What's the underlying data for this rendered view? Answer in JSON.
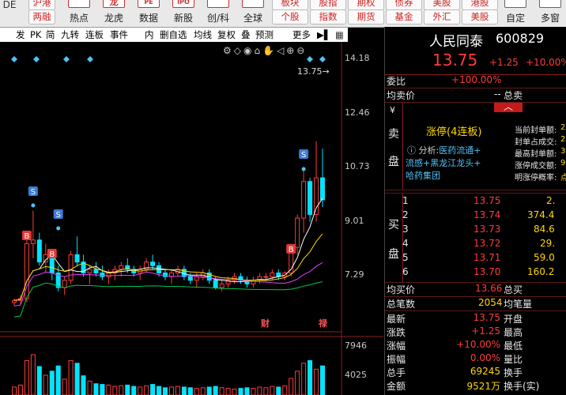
{
  "top": {
    "row1": [
      "沪港",
      "板块",
      "股指",
      "期权",
      "债券",
      "美股",
      "港股"
    ],
    "left_cut": "DE",
    "btn_row": [
      "两融",
      "热点",
      "龙虎",
      "数据",
      "新股",
      "创/科",
      "全球"
    ],
    "icon_lbl": [
      "",
      "",
      "龙",
      "PE",
      "IPO",
      "",
      ""
    ],
    "pills": [
      "个股",
      "指数",
      "期货",
      "基金",
      "外汇",
      "美股"
    ],
    "right": [
      "自定",
      "多窗"
    ]
  },
  "toolbar": [
    "发",
    "PK",
    "简",
    "九转",
    "连板",
    "事件",
    "内",
    "删自选",
    "均线",
    "复权",
    "叠",
    "预测",
    "更多"
  ],
  "chart": {
    "price_labels": [
      "14.18",
      "12.46",
      "10.73",
      "9.01",
      "7.29"
    ],
    "vol_labels": [
      "7946",
      "4025"
    ],
    "last_price_tag": "13.75",
    "marker_s": "S",
    "marker_b": "B",
    "event_a": "财",
    "event_b": "禄"
  },
  "chart_data": {
    "type": "candlestick",
    "y_range": [
      6.9,
      14.5
    ],
    "candles": [
      [
        7.6,
        7.7,
        7.5,
        7.65
      ],
      [
        7.65,
        7.8,
        7.55,
        7.7
      ],
      [
        7.7,
        9.4,
        7.6,
        9.2
      ],
      [
        9.2,
        10.1,
        8.8,
        9.3
      ],
      [
        9.3,
        9.5,
        8.6,
        8.7
      ],
      [
        8.7,
        9.2,
        8.4,
        8.9
      ],
      [
        8.9,
        9.0,
        8.2,
        8.4
      ],
      [
        8.4,
        8.6,
        7.9,
        8.0
      ],
      [
        8.0,
        8.3,
        7.8,
        8.2
      ],
      [
        8.2,
        9.0,
        8.1,
        8.9
      ],
      [
        8.9,
        9.4,
        8.6,
        8.7
      ],
      [
        8.7,
        8.9,
        8.3,
        8.4
      ],
      [
        8.4,
        8.6,
        8.1,
        8.5
      ],
      [
        8.5,
        8.7,
        8.3,
        8.4
      ],
      [
        8.4,
        8.6,
        8.2,
        8.3
      ],
      [
        8.3,
        8.5,
        8.1,
        8.4
      ],
      [
        8.4,
        8.6,
        8.2,
        8.5
      ],
      [
        8.5,
        8.7,
        8.3,
        8.6
      ],
      [
        8.6,
        8.8,
        8.4,
        8.5
      ],
      [
        8.5,
        8.6,
        8.3,
        8.4
      ],
      [
        8.4,
        8.6,
        8.2,
        8.5
      ],
      [
        8.5,
        8.8,
        8.4,
        8.7
      ],
      [
        8.7,
        8.9,
        8.5,
        8.6
      ],
      [
        8.6,
        8.7,
        8.3,
        8.4
      ],
      [
        8.4,
        8.5,
        8.2,
        8.3
      ],
      [
        8.3,
        8.5,
        8.1,
        8.4
      ],
      [
        8.4,
        8.6,
        8.3,
        8.5
      ],
      [
        8.5,
        8.6,
        8.2,
        8.3
      ],
      [
        8.3,
        8.4,
        8.1,
        8.2
      ],
      [
        8.2,
        8.4,
        8.0,
        8.3
      ],
      [
        8.3,
        8.5,
        8.2,
        8.4
      ],
      [
        8.4,
        8.5,
        8.1,
        8.2
      ],
      [
        8.2,
        8.3,
        7.95,
        8.0
      ],
      [
        8.0,
        8.2,
        7.9,
        8.1
      ],
      [
        8.1,
        8.3,
        8.0,
        8.2
      ],
      [
        8.2,
        8.4,
        8.1,
        8.3
      ],
      [
        8.3,
        8.4,
        8.1,
        8.2
      ],
      [
        8.2,
        8.3,
        8.0,
        8.1
      ],
      [
        8.1,
        8.3,
        8.0,
        8.2
      ],
      [
        8.2,
        8.4,
        8.1,
        8.3
      ],
      [
        8.3,
        8.4,
        8.2,
        8.3
      ],
      [
        8.3,
        8.5,
        8.2,
        8.4
      ],
      [
        8.4,
        8.5,
        8.2,
        8.3
      ],
      [
        8.3,
        8.45,
        8.2,
        8.4
      ],
      [
        8.4,
        9.2,
        8.3,
        9.1
      ],
      [
        9.1,
        10.0,
        8.9,
        9.9
      ],
      [
        9.9,
        11.2,
        9.5,
        10.9
      ],
      [
        10.9,
        11.0,
        9.8,
        10.0
      ],
      [
        10.0,
        12.0,
        9.8,
        11.0
      ],
      [
        11.0,
        11.8,
        10.2,
        10.4
      ]
    ],
    "volumes": [
      1200,
      1500,
      5200,
      6100,
      4300,
      3000,
      3600,
      4400,
      2400,
      5200,
      4800,
      2900,
      2100,
      1700,
      1600,
      1500,
      1300,
      1400,
      1500,
      1300,
      1200,
      1400,
      1600,
      1300,
      1100,
      1200,
      1300,
      1200,
      1100,
      1000,
      1100,
      1200,
      1300,
      1100,
      1000,
      900,
      1000,
      1100,
      1000,
      1200,
      1100,
      1300,
      1200,
      1400,
      2500,
      3600,
      4800,
      5200,
      3900,
      4400
    ]
  },
  "right_panel": {
    "name": "人民同泰",
    "code": "600829",
    "price": "13.75",
    "change": "+1.25",
    "pct": "+10.00%",
    "weibi_label": "委比",
    "weibi_val": "+100.00%",
    "junmai_label": "均卖价",
    "junmai_val": "--",
    "zongmai_label": "总卖",
    "sell_char1": "¥",
    "sell_char2": "卖",
    "sell_char3": "盘",
    "limit_up": "涨停(4连板)",
    "analysis_label": "分析:",
    "analysis_line1": "医药流通+",
    "analysis_line2": "流感+黑龙江龙头+",
    "analysis_line3": "哈药集团",
    "stats_labels": [
      "当前封单额:",
      "封单占成交:",
      "最高封单额:",
      "涨停成交额:",
      "明涨停概率:"
    ],
    "stats_vals": [
      "2",
      "2",
      "3",
      "9",
      "点"
    ],
    "buy_char1": "买",
    "buy_char2": "盘",
    "buys": [
      {
        "lvl": "1",
        "price": "13.75",
        "vol": "2."
      },
      {
        "lvl": "2",
        "price": "13.74",
        "vol": "374.4"
      },
      {
        "lvl": "3",
        "price": "13.73",
        "vol": "84.6"
      },
      {
        "lvl": "4",
        "price": "13.72",
        "vol": "29."
      },
      {
        "lvl": "5",
        "price": "13.71",
        "vol": "59.0"
      },
      {
        "lvl": "6",
        "price": "13.70",
        "vol": "160.2"
      }
    ],
    "junbuy_label": "均买价",
    "junbuy_val": "13.66",
    "zongbuy_label": "总买",
    "zongbi_label": "总笔数",
    "zongbi_val": "2054",
    "junbi_label": "均笔量",
    "quotes": [
      {
        "l": "最新",
        "v": "13.75",
        "r": "开盘",
        "c": "red"
      },
      {
        "l": "涨跌",
        "v": "+1.25",
        "r": "最高",
        "c": "red"
      },
      {
        "l": "涨幅",
        "v": "+10.00%",
        "r": "最低",
        "c": "red"
      },
      {
        "l": "振幅",
        "v": "0.00%",
        "r": "量比",
        "c": "red"
      },
      {
        "l": "总手",
        "v": "69245",
        "r": "换手",
        "c": "yellow"
      },
      {
        "l": "金额",
        "v": "9521万",
        "r": "换手(实)",
        "c": "yellow"
      }
    ]
  }
}
